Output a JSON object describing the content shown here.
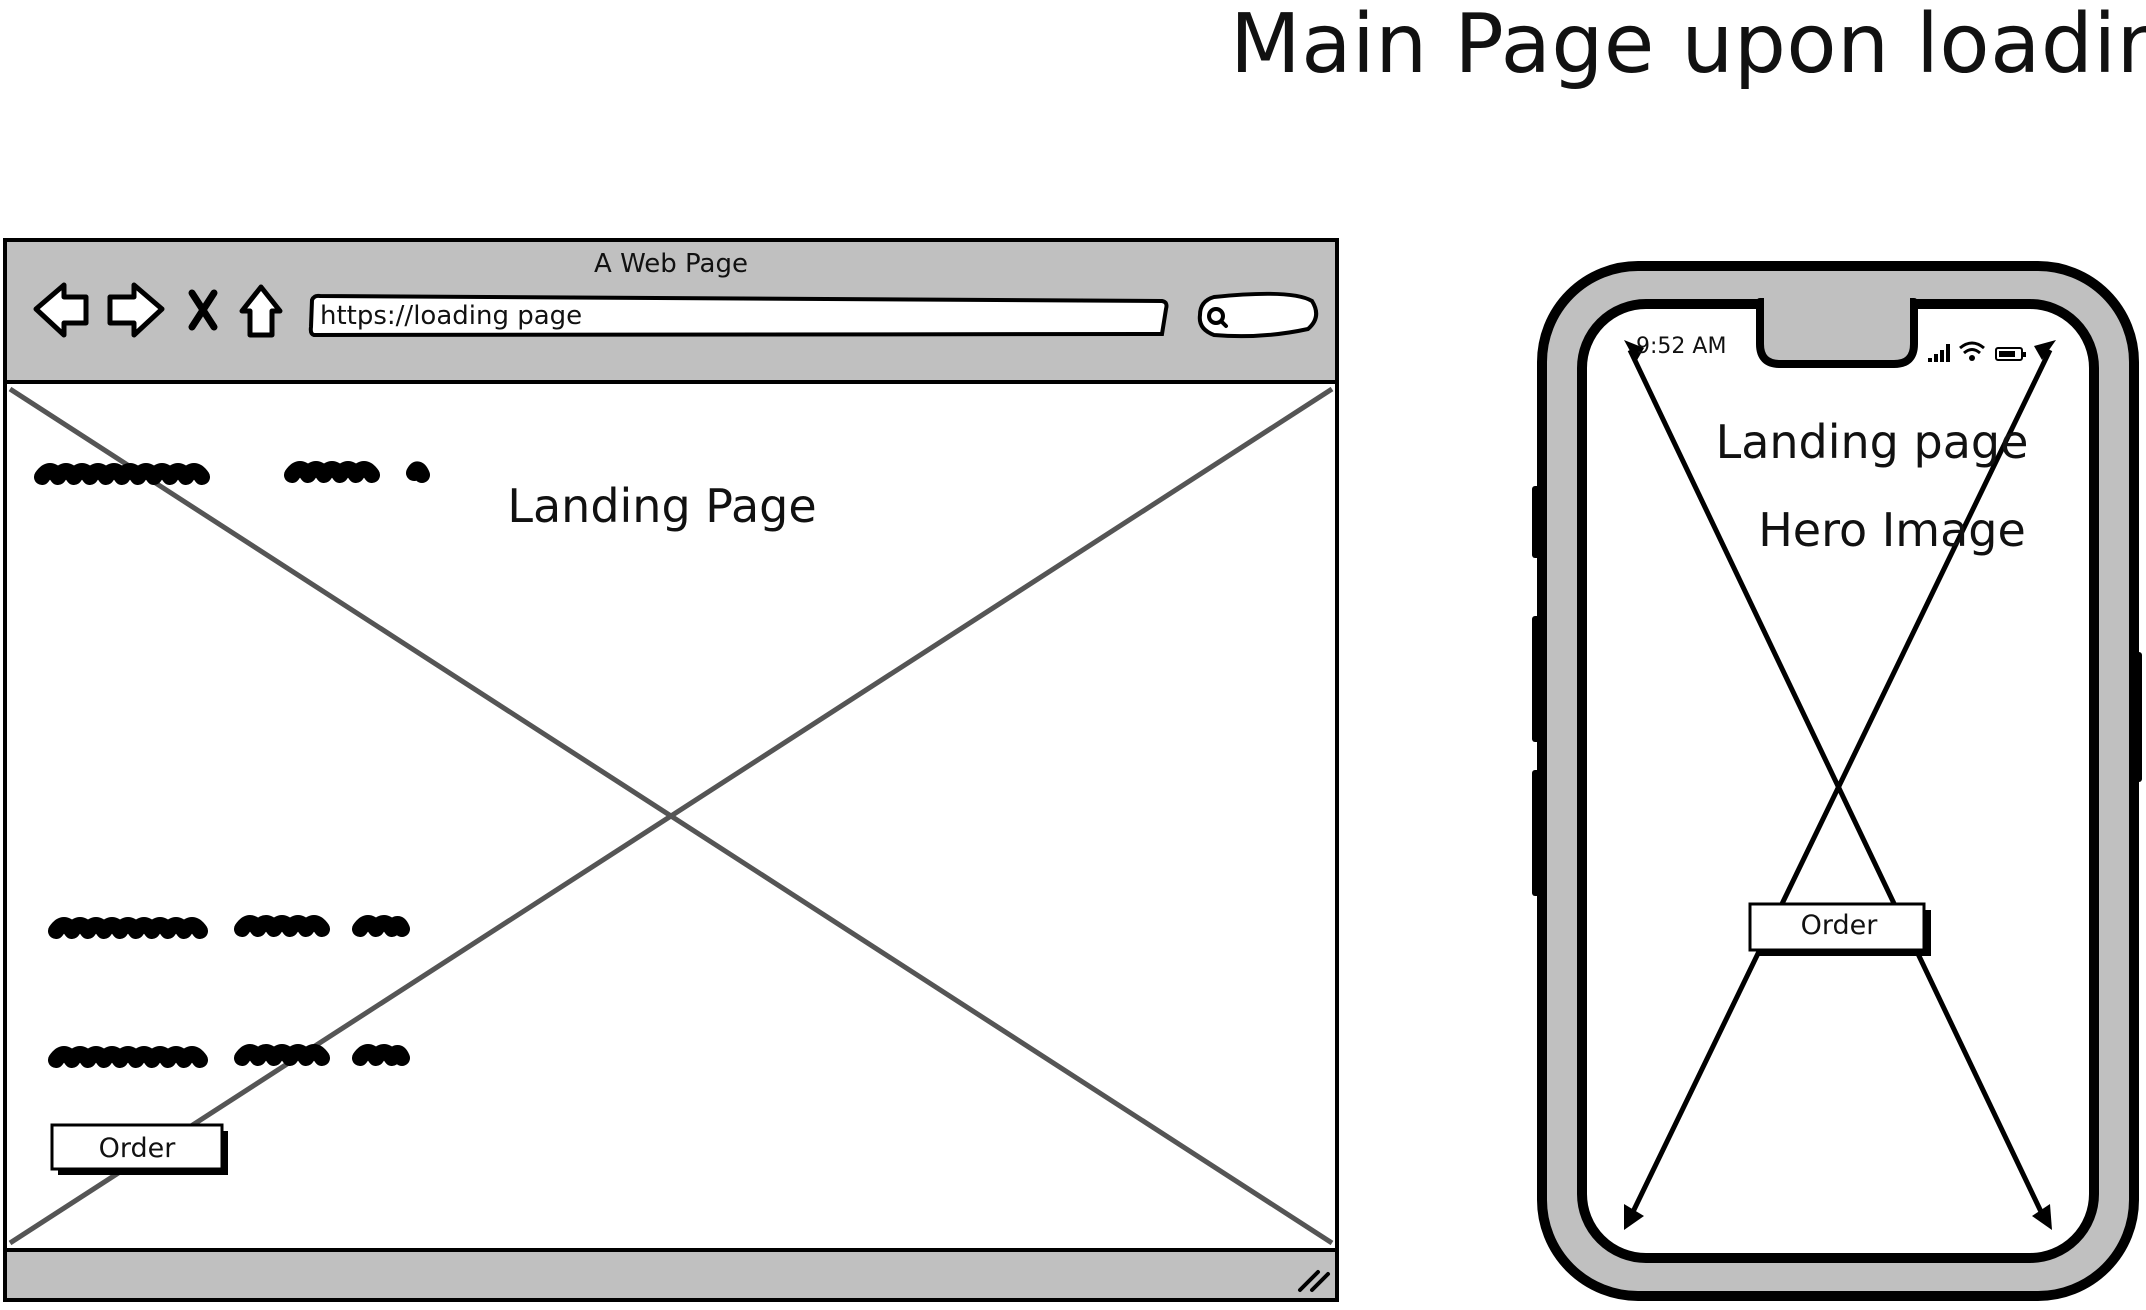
{
  "header": {
    "title": "Main Page upon loading"
  },
  "browser": {
    "window_title": "A Web Page",
    "address_bar": {
      "value": "https://loading page"
    },
    "nav_icons": [
      "back-arrow-icon",
      "forward-arrow-icon",
      "close-icon",
      "home-icon",
      "search-icon"
    ],
    "landing_title": "Landing Page",
    "order_button": "Order"
  },
  "phone": {
    "status_time": "9:52 AM",
    "status_icons": [
      "signal-icon",
      "wifi-icon",
      "battery-icon"
    ],
    "landing_title": "Landing page",
    "hero_label": "Hero Image",
    "order_button": "Order"
  },
  "colors": {
    "frame_gray": "#c0c0c0",
    "line": "#000000",
    "placeholder_line": "#555555"
  }
}
